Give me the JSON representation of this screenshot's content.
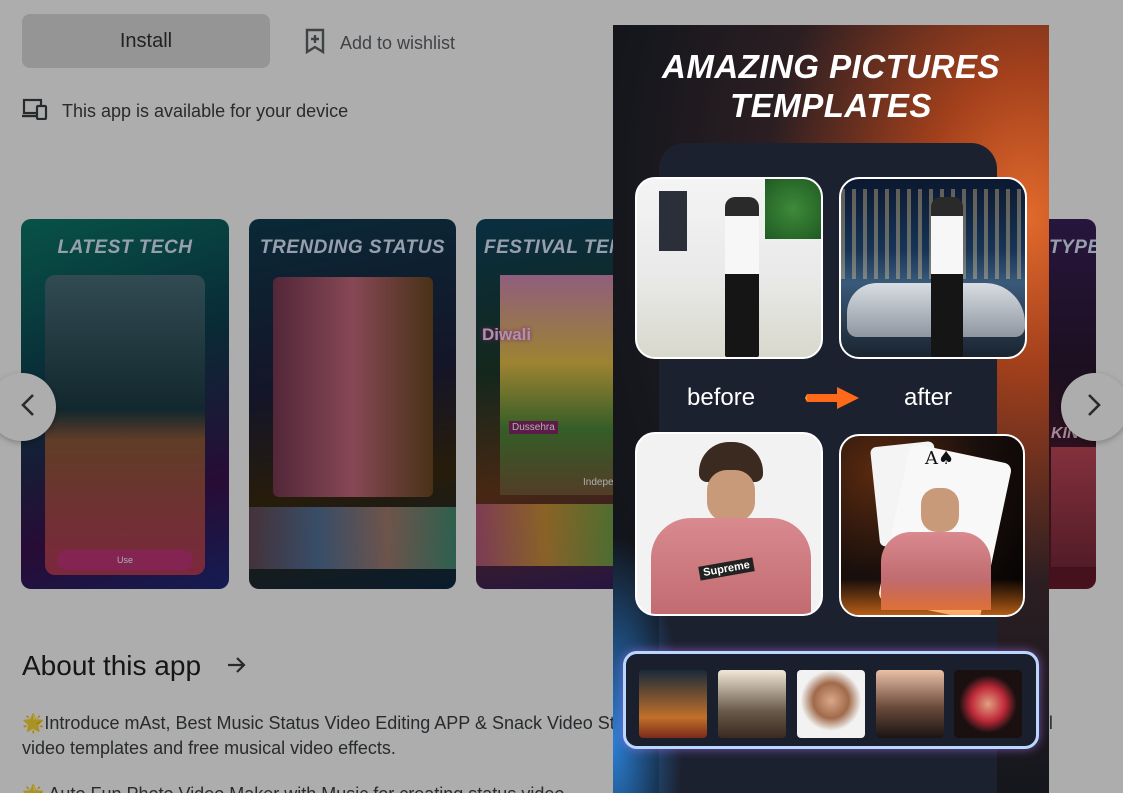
{
  "page": {
    "install_label": "Install",
    "wishlist_label": "Add to wishlist",
    "device_notice": "This app is available for your device",
    "about_title": "About this app",
    "about_paragraph": "🌟Introduce mAst, Best Music Status Video Editing APP & Snack Video Status Maker! Edit clips and photos with numerous lyrical video templates and free musical video effects.",
    "about_line3": "🌟 Auto Fun Photo Video Maker with Music for creating status video"
  },
  "screenshots": [
    {
      "title": "LATEST TECH",
      "inner_label": "Use"
    },
    {
      "title": "TRENDING STATUS"
    },
    {
      "title": "FESTIVAL TEMP",
      "tags": [
        "Diwali",
        "Dussehra",
        "Indepe"
      ]
    },
    {
      "title": "TYPES",
      "tag": "KIN"
    }
  ],
  "viewer": {
    "title_line1": "AMAZING PICTURES",
    "title_line2": "TEMPLATES",
    "before_label": "before",
    "after_label": "after",
    "hoodie_text": "Supreme"
  },
  "colors": {
    "accent_orange": "#ff6a1a",
    "panel_dark": "#1c2130",
    "strip_border": "#b9d7ff"
  },
  "icons": {
    "wishlist": "bookmark-add-icon",
    "device": "devices-icon",
    "prev": "chevron-left-icon",
    "next": "chevron-right-icon",
    "about_arrow": "arrow-right-icon",
    "before_after": "fire-arrow-icon"
  }
}
